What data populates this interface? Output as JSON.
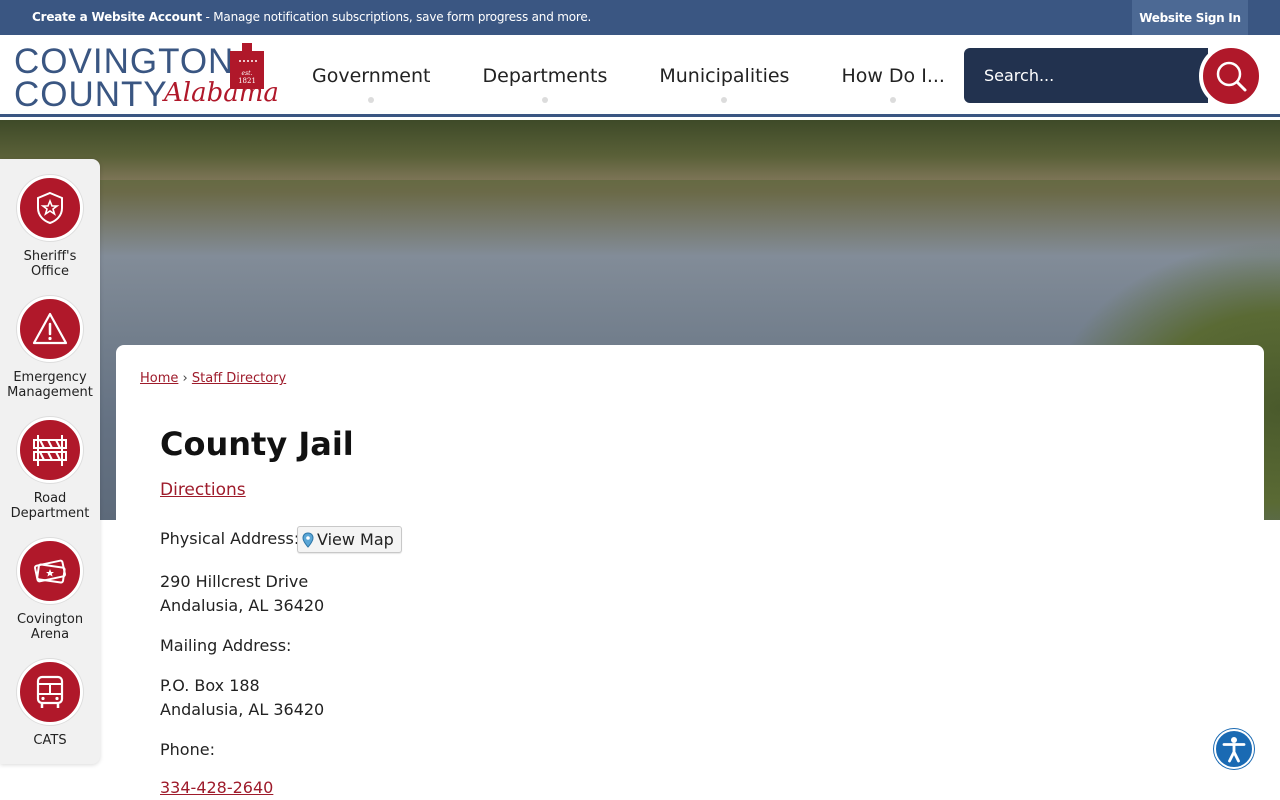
{
  "topbar": {
    "account_bold": "Create a Website Account",
    "account_rest": " - Manage notification subscriptions, save form progress and more.",
    "signin": "Website Sign In"
  },
  "logo": {
    "line1": "COVINGTON",
    "line2": "COUNTY",
    "script": "Alabama",
    "seal": "est. 1821"
  },
  "nav": [
    "Government",
    "Departments",
    "Municipalities",
    "How Do I..."
  ],
  "search": {
    "placeholder": "Search..."
  },
  "quick_links": [
    {
      "label_line1": "Sheriff's",
      "label_line2": "Office",
      "icon": "badge-icon"
    },
    {
      "label_line1": "Emergency",
      "label_line2": "Management",
      "icon": "warning-icon"
    },
    {
      "label_line1": "Road",
      "label_line2": "Department",
      "icon": "barrier-icon"
    },
    {
      "label_line1": "Covington",
      "label_line2": "Arena",
      "icon": "tickets-icon"
    },
    {
      "label_line1": "CATS",
      "label_line2": "",
      "icon": "bus-icon"
    }
  ],
  "breadcrumb": {
    "home": "Home",
    "sep": "›",
    "current": "Staff Directory"
  },
  "page": {
    "title": "County Jail",
    "directions": "Directions",
    "physical_label": "Physical Address:",
    "view_map": "View Map",
    "physical_line1": "290 Hillcrest Drive",
    "physical_line2": "Andalusia, AL 36420",
    "mailing_label": "Mailing Address:",
    "mailing_line1": "P.O. Box 188",
    "mailing_line2": "Andalusia, AL 36420",
    "phone_label": "Phone:",
    "phone": "334-428-2640"
  },
  "colors": {
    "brand_blue": "#3a5682",
    "brand_red": "#b0182a",
    "link": "#9e1b2b"
  }
}
